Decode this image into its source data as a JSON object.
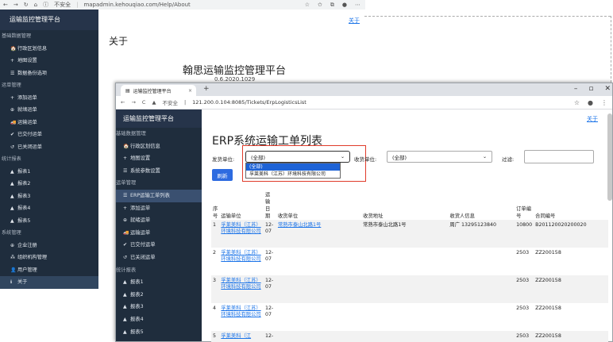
{
  "back_browser": {
    "security": "不安全",
    "url": "mapadmin.kehouqiao.com/Help/About",
    "link_top": "关于",
    "page_title": "关于",
    "app_title": "翰思运输监控管理平台",
    "version": "0.6.2020.1029",
    "sidebar": {
      "brand": "运输监控管理平台",
      "items": [
        {
          "type": "group",
          "label": "基础数据管理"
        },
        {
          "type": "item",
          "icon": "🏠",
          "label": "行政区划信息"
        },
        {
          "type": "item",
          "icon": "+",
          "label": "地图设置"
        },
        {
          "type": "item",
          "icon": "☰",
          "label": "数据备份选项"
        },
        {
          "type": "group",
          "label": "运单管理"
        },
        {
          "type": "item",
          "icon": "+",
          "label": "添加运单"
        },
        {
          "type": "item",
          "icon": "⊕",
          "label": "就绪运单"
        },
        {
          "type": "item",
          "icon": "🚚",
          "label": "运输运单"
        },
        {
          "type": "item",
          "icon": "✔",
          "label": "已交付运单"
        },
        {
          "type": "item",
          "icon": "↺",
          "label": "已关闭运单"
        },
        {
          "type": "group",
          "label": "统计报表"
        },
        {
          "type": "item",
          "icon": "▲",
          "label": "报表1"
        },
        {
          "type": "item",
          "icon": "▲",
          "label": "报表2"
        },
        {
          "type": "item",
          "icon": "▲",
          "label": "报表3"
        },
        {
          "type": "item",
          "icon": "▲",
          "label": "报表4"
        },
        {
          "type": "item",
          "icon": "▲",
          "label": "报表5"
        },
        {
          "type": "group",
          "label": "系统管理"
        },
        {
          "type": "item",
          "icon": "⊕",
          "label": "企业注册"
        },
        {
          "type": "item",
          "icon": "⁂",
          "label": "组织机构管理"
        },
        {
          "type": "item",
          "icon": "👤",
          "label": "用户管理"
        },
        {
          "type": "item",
          "icon": "ℹ",
          "label": "关于",
          "active": true
        }
      ]
    }
  },
  "front_browser": {
    "tab_title": "运输监控管理平台",
    "new_tab": "+",
    "security": "不安全",
    "url": "121.200.0.104:8085/Tickets/ErpLogisticsList",
    "link_top": "关于",
    "heading": "ERP系统运输工单列表",
    "filters": {
      "sender_label": "发货单位:",
      "sender_value": "(全部)",
      "sender_options": [
        "(全部)",
        "孚莱美科（江苏）环境科技有限公司"
      ],
      "receiver_label": "收货单位:",
      "receiver_value": "(全部)",
      "filter_label": "过滤:",
      "refresh_label": "刷新"
    },
    "sidebar": {
      "brand": "运输监控管理平台",
      "items": [
        {
          "type": "group",
          "label": "基础数据管理"
        },
        {
          "type": "item",
          "icon": "🏠",
          "label": "行政区划信息"
        },
        {
          "type": "item",
          "icon": "+",
          "label": "地图设置"
        },
        {
          "type": "item",
          "icon": "☰",
          "label": "系统参数设置"
        },
        {
          "type": "group",
          "label": "运单管理"
        },
        {
          "type": "item",
          "icon": "☰",
          "label": "ERP运输工单列表",
          "active": true
        },
        {
          "type": "item",
          "icon": "+",
          "label": "添加运单"
        },
        {
          "type": "item",
          "icon": "⊕",
          "label": "就绪运单"
        },
        {
          "type": "item",
          "icon": "🚚",
          "label": "运输运单"
        },
        {
          "type": "item",
          "icon": "✔",
          "label": "已交付运单"
        },
        {
          "type": "item",
          "icon": "↺",
          "label": "已关闭运单"
        },
        {
          "type": "group",
          "label": "统计报表"
        },
        {
          "type": "item",
          "icon": "▲",
          "label": "报表1"
        },
        {
          "type": "item",
          "icon": "▲",
          "label": "报表2"
        },
        {
          "type": "item",
          "icon": "▲",
          "label": "报表3"
        },
        {
          "type": "item",
          "icon": "▲",
          "label": "报表4"
        },
        {
          "type": "item",
          "icon": "▲",
          "label": "报表5"
        }
      ]
    },
    "table": {
      "headers": [
        "序号",
        "运输单位",
        "运输日期",
        "收货单位",
        "收货地址",
        "收货人信息",
        "订单编号",
        "合同编号"
      ],
      "rows": [
        {
          "no": "1",
          "carrier": "孚莱美科（江苏）环境科技有限公司",
          "date": "12-07",
          "receiver": "常熟市泰山北路1号",
          "address": "常熟市泰山北路1号",
          "contact": "周广 13295123840",
          "order": "10800",
          "contract": "B201120020200020"
        },
        {
          "no": "2",
          "carrier": "孚莱美科（江苏）环境科技有限公司",
          "date": "12-07",
          "receiver": "",
          "address": "",
          "contact": "",
          "order": "2503",
          "contract": "ZZ200158"
        },
        {
          "no": "3",
          "carrier": "孚莱美科（江苏）环境科技有限公司",
          "date": "12-07",
          "receiver": "",
          "address": "",
          "contact": "",
          "order": "2503",
          "contract": "ZZ200158"
        },
        {
          "no": "4",
          "carrier": "孚莱美科（江苏）环境科技有限公司",
          "date": "12-07",
          "receiver": "",
          "address": "",
          "contact": "",
          "order": "2503",
          "contract": "ZZ200158"
        },
        {
          "no": "5",
          "carrier": "孚莱美科（江",
          "date": "12-",
          "receiver": "",
          "address": "",
          "contact": "",
          "order": "2503",
          "contract": "ZZ200158"
        }
      ]
    }
  }
}
